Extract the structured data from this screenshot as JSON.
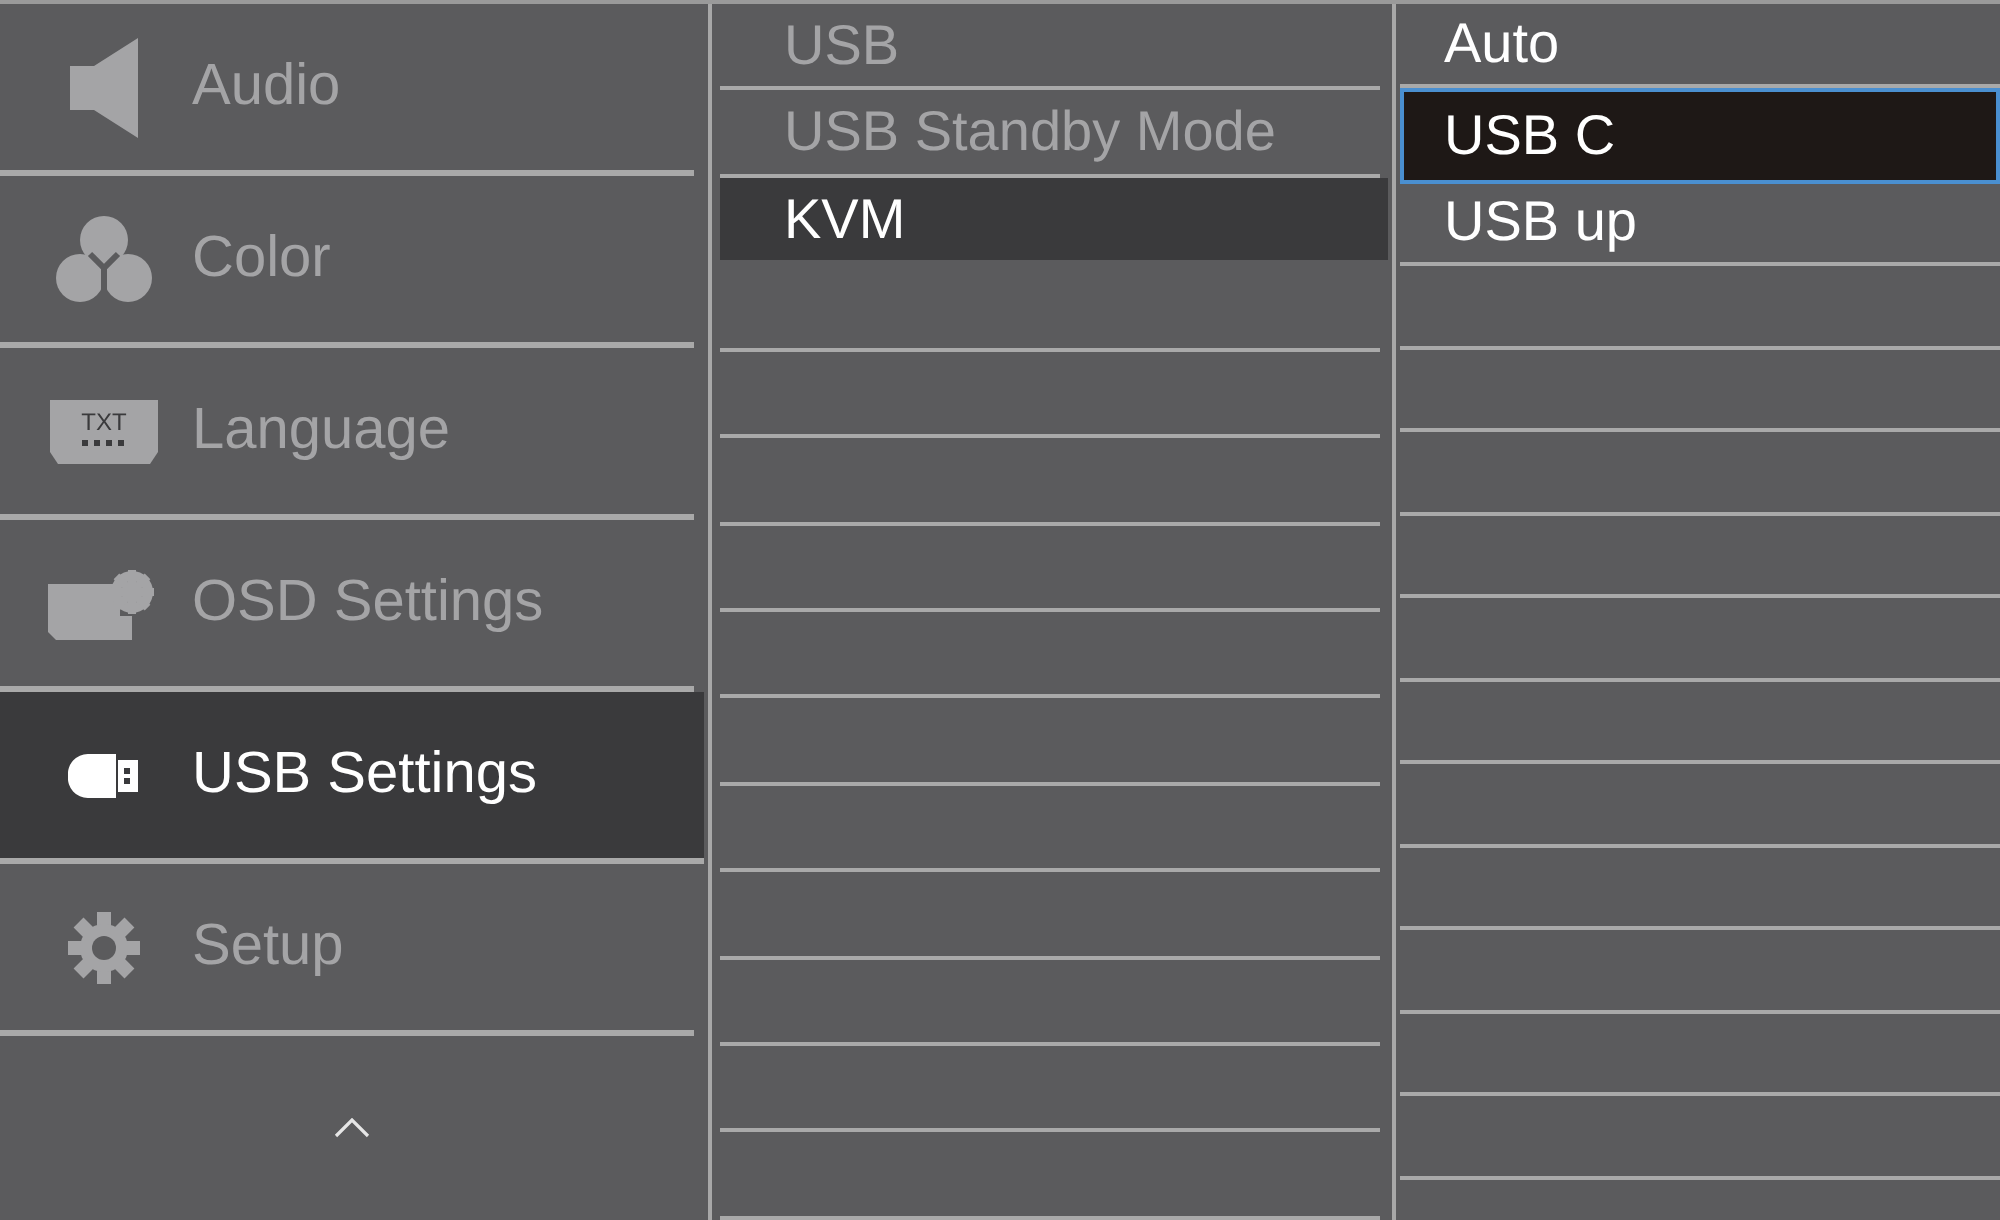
{
  "main_menu": [
    {
      "label": "Audio",
      "selected": false
    },
    {
      "label": "Color",
      "selected": false
    },
    {
      "label": "Language",
      "badge_text": "TXT",
      "selected": false
    },
    {
      "label": "OSD Settings",
      "selected": false
    },
    {
      "label": "USB Settings",
      "selected": true
    },
    {
      "label": "Setup",
      "selected": false
    }
  ],
  "submenu": [
    {
      "label": "USB",
      "selected": false
    },
    {
      "label": "USB Standby Mode",
      "selected": false
    },
    {
      "label": "KVM",
      "selected": true
    }
  ],
  "options": [
    {
      "label": "Auto",
      "selected": false
    },
    {
      "label": "USB C",
      "selected": true
    },
    {
      "label": "USB up",
      "selected": false
    }
  ]
}
